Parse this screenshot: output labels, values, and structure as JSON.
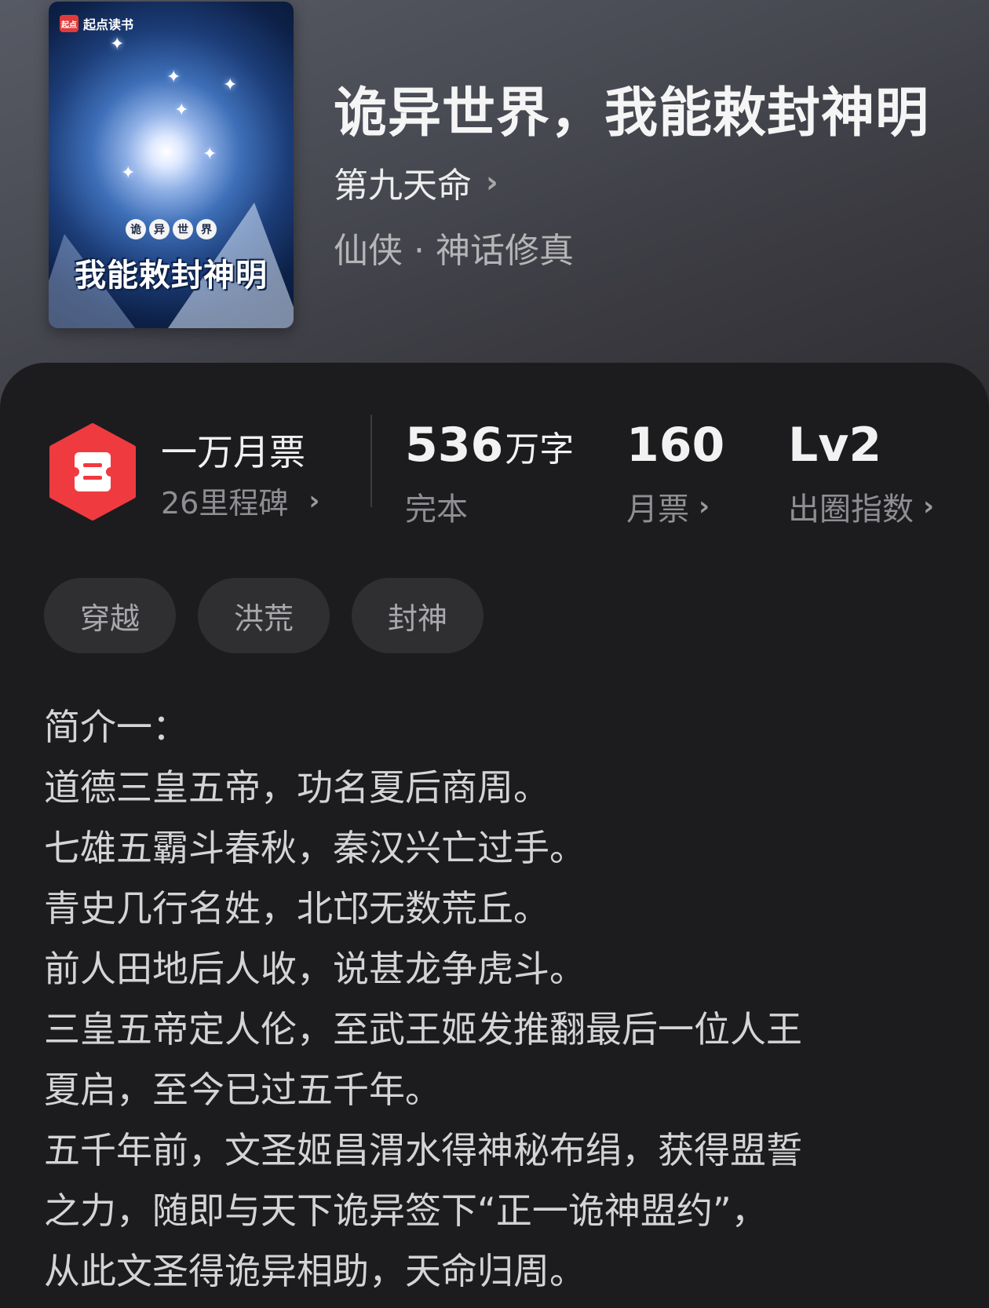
{
  "book": {
    "title": "诡异世界，我能敕封神明",
    "author": "第九天命",
    "genre": "仙侠 · 神话修真"
  },
  "cover": {
    "brand": "起点读书",
    "brand_logo": "起点",
    "subtitle_chars": [
      "诡",
      "异",
      "世",
      "界"
    ],
    "title": "我能敕封神明"
  },
  "stats": {
    "honor_title": "一万月票",
    "honor_sub": "26里程碑",
    "word_count": "536",
    "word_unit": "万字",
    "status": "完本",
    "monthly_tickets": "160",
    "monthly_label": "月票",
    "circle_level": "Lv2",
    "circle_label": "出圈指数"
  },
  "tags": [
    "穿越",
    "洪荒",
    "封神"
  ],
  "intro_lines": [
    "简介一：",
    "道德三皇五帝，功名夏后商周。",
    "七雄五霸斗春秋，秦汉兴亡过手。",
    "青史几行名姓，北邙无数荒丘。",
    "前人田地后人收，说甚龙争虎斗。",
    "三皇五帝定人伦，至武王姬发推翻最后一位人王",
    "夏启，至今已过五千年。",
    "五千年前，文圣姬昌渭水得神秘布绢，获得盟誓",
    "之力，随即与天下诡异签下“正一诡神盟约”，",
    "从此文圣得诡异相助，天命归周。"
  ],
  "colors": {
    "badge_red": "#ef3b40",
    "panel_bg": "#1c1c1e",
    "tag_bg": "#2f2f32"
  },
  "icons": {
    "badge": "ticket-badge-icon",
    "chevron": "chevron-right-icon"
  }
}
